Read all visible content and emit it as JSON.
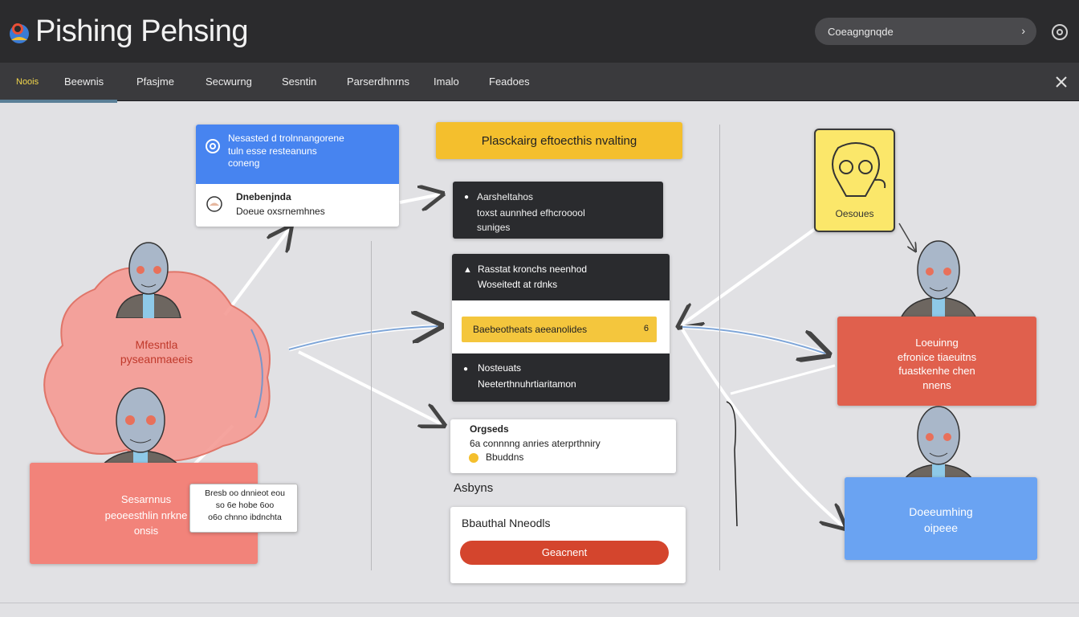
{
  "app": {
    "title": "Pishing Pehsing",
    "search_value": "Coeagngnqde"
  },
  "nav": {
    "items": [
      "Noois",
      "Beewnis",
      "Pfasjme",
      "Secwurng",
      "Sesntin",
      "Parserdhnrns",
      "Imalo",
      "Feadoes"
    ]
  },
  "diagram": {
    "email_card": {
      "header_lines": [
        "Nesasted d trolnnangorene",
        "tuln esse resteanuns",
        "coneng"
      ],
      "sender": "Dnebenjnda",
      "subject": "Doeue oxsrnemhnes"
    },
    "title_banner": "Plasckairg eftoecthis nvalting",
    "step1": {
      "title": "Aarsheltahos",
      "lines": [
        "toxst aunnhed efhcrooool",
        "suniges"
      ]
    },
    "step2": {
      "title": "Rasstat kronchs neenhod",
      "lines": [
        "Woseitedt at rdnks"
      ]
    },
    "step2_alert": {
      "text": "Baebeotheats aeeanolides",
      "count": "6"
    },
    "step3": {
      "title": "Nosteuats",
      "lines": [
        "Neeterthnuhrtiaritamon"
      ]
    },
    "step4": {
      "title": "Orgseds",
      "lines": [
        "6a connnng anries aterprthniry",
        "Bbuddns"
      ]
    },
    "section_label": "Asbyns",
    "action_card": {
      "title": "Bbauthal Nneodls",
      "button": "Geacnent"
    },
    "left_cloud": {
      "lines": [
        "Mfesntla",
        "pyseanmaeeis"
      ]
    },
    "left_panel": {
      "lines": [
        "Sesarnnus",
        "peoeesthlin nrkne",
        "onsis"
      ]
    },
    "left_note": {
      "lines": [
        "Bresb oo dnnieot eou",
        "so 6e hobe 6oo",
        "o6o chnno ibdnchta"
      ]
    },
    "right_yellow": {
      "label": "Oesoues"
    },
    "right_red": {
      "lines": [
        "Loeuinng",
        "efronice tiaeuitns",
        "fuastkenhe chen",
        "nnens"
      ]
    },
    "right_blue": {
      "lines": [
        "Doeeumhing",
        "oipeee"
      ]
    }
  },
  "colors": {
    "header_bg": "#2b2b2d",
    "nav_bg": "#3a3a3d",
    "accent_blue": "#4784f0",
    "accent_yellow": "#f4bf2d",
    "accent_red": "#e0604d",
    "salmon": "#f2837a",
    "light_blue": "#6aa3f2",
    "dark_card": "#2a2b2e",
    "button_red": "#d4452d"
  },
  "icons": {
    "logo": "globe-user-icon",
    "settings": "gear-icon",
    "close": "close-icon",
    "search_chevron": "chevron-right-icon"
  }
}
